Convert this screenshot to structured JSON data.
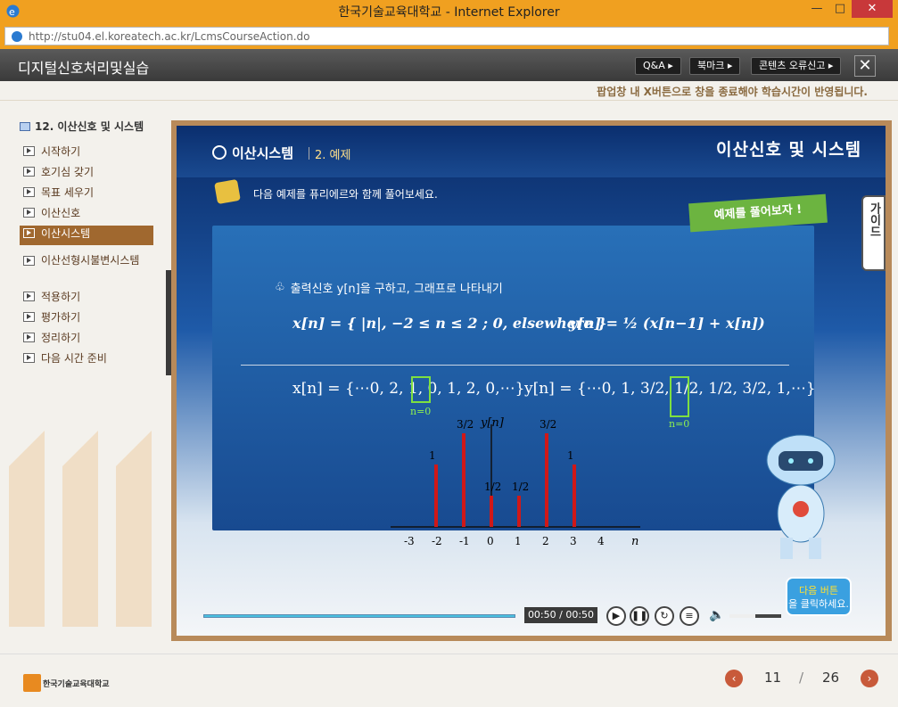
{
  "window": {
    "title": "한국기술교육대학교 - Internet Explorer",
    "min": "—",
    "max": "□",
    "close": "✕"
  },
  "address": {
    "url": "http://stu04.el.koreatech.ac.kr/LcmsCourseAction.do"
  },
  "header": {
    "course_title": "디지털신호처리및실습",
    "qa": "Q&A ▸",
    "bookmark": "북마크 ▸",
    "report": "콘텐츠 오류신고 ▸",
    "close": "✕"
  },
  "notice": "팝업창 내 X버튼으로 창을 종료해야 학습시간이 반영됩니다.",
  "sidebar": {
    "chapter": "12. 이산신호 및 시스템",
    "items": [
      {
        "label": "시작하기"
      },
      {
        "label": "호기심 갖기"
      },
      {
        "label": "목표 세우기"
      },
      {
        "label": "이산신호"
      },
      {
        "label": "이산시스템",
        "active": true
      },
      {
        "label": "이산선형시불변시스템"
      },
      {
        "label": "적용하기"
      },
      {
        "label": "평가하기"
      },
      {
        "label": "정리하기"
      },
      {
        "label": "다음 시간 준비"
      }
    ]
  },
  "content": {
    "section": "이산시스템",
    "subsection": "2. 예제",
    "heading": "이산신호 및 시스템",
    "instruction": "다음 예제를 퓨리에르와 함께 풀어보세요.",
    "badge": "예제를 풀어보자 !",
    "guide": "가이드",
    "problem": "출력신호 y[n]을 구하고, 그래프로 나타내기",
    "eq_x": "x[n] = { |n|,   −2 ≤ n ≤ 2 ;  0,   elsewhere }",
    "eq_y": "y[n] = ½ (x[n−1] + x[n])",
    "seq_x": "x[n] = {⋯0, 2, 1, 0, 1, 2, 0,⋯}",
    "seq_y": "y[n] = {⋯0, 1, 3/2, 1/2, 1/2, 3/2, 1,⋯}",
    "n0": "n=0",
    "next_hint_1": "다음 버튼",
    "next_hint_2": "을 클릭하세요."
  },
  "chart_data": {
    "type": "bar",
    "ylabel": "y[n]",
    "xlabel": "n",
    "x": [
      -3,
      -2,
      -1,
      0,
      1,
      2,
      3,
      4
    ],
    "values": [
      0,
      1,
      1.5,
      0.5,
      0.5,
      1.5,
      1,
      0
    ],
    "labels": [
      "",
      "1",
      "3/2",
      "1/2",
      "1/2",
      "3/2",
      "1",
      ""
    ]
  },
  "player": {
    "time": "00:50 / 00:50",
    "progress": 1.0,
    "volume": 0.5,
    "play": "▶",
    "pause": "❚❚",
    "replay": "↻",
    "menu": "≡",
    "speaker": "🔈"
  },
  "footer": {
    "school": "한국기술교육대학교",
    "page": "11",
    "sep": "/",
    "total": "26",
    "prev": "‹",
    "next": "›"
  },
  "colors": {
    "titlebar": "#f0a020",
    "accent": "#a0682f",
    "highlight": "#7ee040"
  }
}
